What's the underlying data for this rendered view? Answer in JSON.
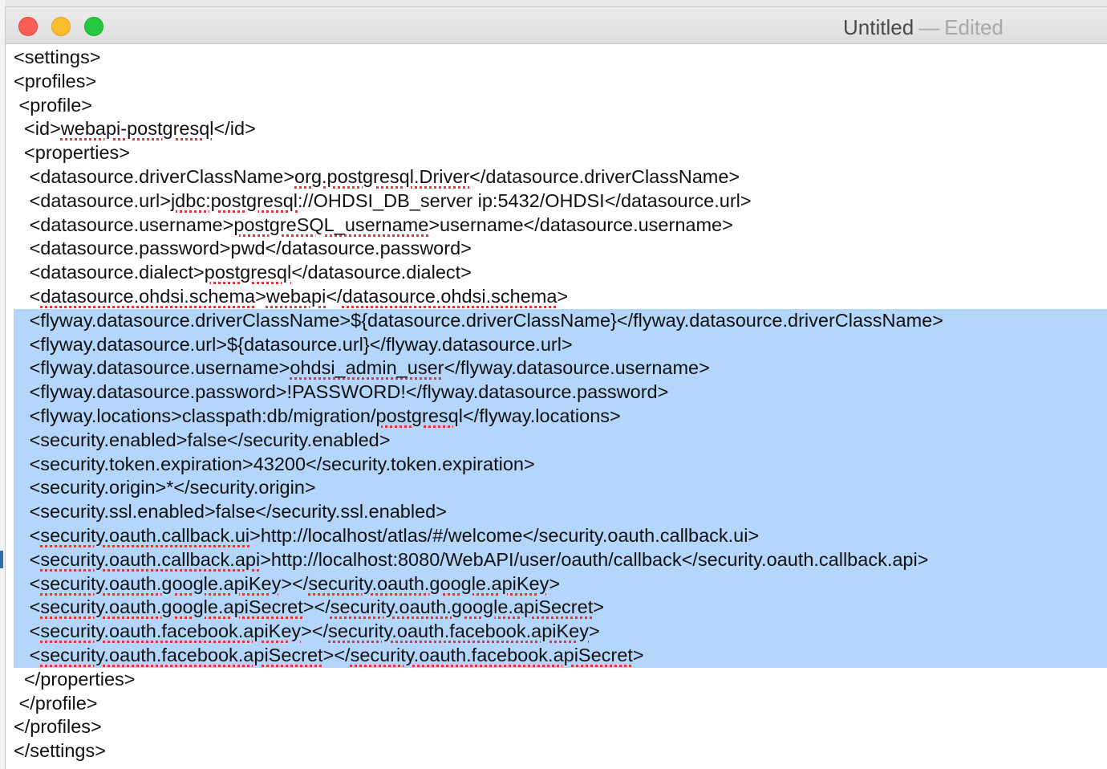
{
  "window": {
    "title": "Untitled",
    "title_separator": "—",
    "title_state": "Edited"
  },
  "colors": {
    "selection": "#b4d6fb",
    "spellcheck_underline": "#e0383a",
    "close_button": "#fd5e56",
    "minimize_button": "#fdbb2f",
    "zoom_button": "#27c840"
  },
  "editor": {
    "lines": [
      {
        "selected": false,
        "segments": [
          {
            "text": "<settings>"
          }
        ]
      },
      {
        "selected": false,
        "segments": [
          {
            "text": "<profiles>"
          }
        ]
      },
      {
        "selected": false,
        "segments": [
          {
            "text": " <profile>"
          }
        ]
      },
      {
        "selected": false,
        "segments": [
          {
            "text": "  <id>"
          },
          {
            "text": "webapi-postgresql",
            "misspelled": true
          },
          {
            "text": "</id>"
          }
        ]
      },
      {
        "selected": false,
        "segments": [
          {
            "text": "  <properties>"
          }
        ]
      },
      {
        "selected": false,
        "segments": [
          {
            "text": "   <datasource.driverClassName>"
          },
          {
            "text": "org.postgresql.Driver",
            "misspelled": true
          },
          {
            "text": "</datasource.driverClassName>"
          }
        ]
      },
      {
        "selected": false,
        "segments": [
          {
            "text": "   <datasource.url>"
          },
          {
            "text": "jdbc:postgresql",
            "misspelled": true
          },
          {
            "text": "://OHDSI_DB_server ip:5432/OHDSI</datasource.url>"
          }
        ]
      },
      {
        "selected": false,
        "segments": [
          {
            "text": "   <datasource.username>"
          },
          {
            "text": "postgreSQL_username",
            "misspelled": true
          },
          {
            "text": ">username</datasource.username>"
          }
        ]
      },
      {
        "selected": false,
        "segments": [
          {
            "text": "   <datasource.password>pwd</datasource.password>"
          }
        ]
      },
      {
        "selected": false,
        "segments": [
          {
            "text": "   <datasource.dialect>"
          },
          {
            "text": "postgresql",
            "misspelled": true
          },
          {
            "text": "</datasource.dialect>"
          }
        ]
      },
      {
        "selected": false,
        "segments": [
          {
            "text": "   <"
          },
          {
            "text": "datasource.ohdsi.schema",
            "misspelled": true
          },
          {
            "text": ">"
          },
          {
            "text": "webapi",
            "misspelled": true
          },
          {
            "text": "</"
          },
          {
            "text": "datasource.ohdsi.schema",
            "misspelled": true
          },
          {
            "text": ">"
          }
        ]
      },
      {
        "selected": true,
        "segments": [
          {
            "text": "   <flyway.datasource.driverClassName>${datasource.driverClassName}</flyway.datasource.driverClassName>"
          }
        ]
      },
      {
        "selected": true,
        "segments": [
          {
            "text": "   <flyway.datasource.url>${datasource.url}</flyway.datasource.url>"
          }
        ]
      },
      {
        "selected": true,
        "segments": [
          {
            "text": "   <flyway.datasource.username>"
          },
          {
            "text": "ohdsi_admin_user",
            "misspelled": true
          },
          {
            "text": "</flyway.datasource.username>"
          }
        ]
      },
      {
        "selected": true,
        "segments": [
          {
            "text": "   <flyway.datasource.password>!PASSWORD!</flyway.datasource.password>"
          }
        ]
      },
      {
        "selected": true,
        "segments": [
          {
            "text": "   <flyway.locations>classpath:db/migration/"
          },
          {
            "text": "postgresql",
            "misspelled": true
          },
          {
            "text": "</flyway.locations>"
          }
        ]
      },
      {
        "selected": true,
        "segments": [
          {
            "text": "   <security.enabled>false</security.enabled>"
          }
        ]
      },
      {
        "selected": true,
        "segments": [
          {
            "text": "   <security.token.expiration>43200</security.token.expiration>"
          }
        ]
      },
      {
        "selected": true,
        "segments": [
          {
            "text": "   <security.origin>*</security.origin>"
          }
        ]
      },
      {
        "selected": true,
        "segments": [
          {
            "text": "   <security.ssl.enabled>false</security.ssl.enabled>"
          }
        ]
      },
      {
        "selected": true,
        "segments": [
          {
            "text": "   <"
          },
          {
            "text": "security.oauth.callback.ui",
            "misspelled": true
          },
          {
            "text": ">http://localhost/atlas/#/welcome</security.oauth.callback.ui>"
          }
        ]
      },
      {
        "selected": true,
        "segments": [
          {
            "text": "   <"
          },
          {
            "text": "security.oauth.callback.api",
            "misspelled": true
          },
          {
            "text": ">http://localhost:8080/WebAPI/user/oauth/callback</security.oauth.callback.api>"
          }
        ]
      },
      {
        "selected": true,
        "segments": [
          {
            "text": "   <"
          },
          {
            "text": "security.oauth.google.apiKey",
            "misspelled": true
          },
          {
            "text": "></"
          },
          {
            "text": "security.oauth.google.apiKey",
            "misspelled": true
          },
          {
            "text": ">"
          }
        ]
      },
      {
        "selected": true,
        "segments": [
          {
            "text": "   <"
          },
          {
            "text": "security.oauth.google.apiSecret",
            "misspelled": true
          },
          {
            "text": "></"
          },
          {
            "text": "security.oauth.google.apiSecret",
            "misspelled": true
          },
          {
            "text": ">"
          }
        ]
      },
      {
        "selected": true,
        "segments": [
          {
            "text": "   <"
          },
          {
            "text": "security.oauth.facebook.apiKey",
            "misspelled": true
          },
          {
            "text": "></"
          },
          {
            "text": "security.oauth.facebook.apiKey",
            "misspelled": true
          },
          {
            "text": ">"
          }
        ]
      },
      {
        "selected": true,
        "segments": [
          {
            "text": "   <"
          },
          {
            "text": "security.oauth.facebook.apiSecret",
            "misspelled": true
          },
          {
            "text": "></"
          },
          {
            "text": "security.oauth.facebook.apiSecret",
            "misspelled": true
          },
          {
            "text": ">"
          }
        ]
      },
      {
        "selected": false,
        "segments": [
          {
            "text": "  </properties>"
          }
        ]
      },
      {
        "selected": false,
        "segments": [
          {
            "text": " </profile>"
          }
        ]
      },
      {
        "selected": false,
        "segments": [
          {
            "text": "</profiles>"
          }
        ]
      },
      {
        "selected": false,
        "segments": [
          {
            "text": "</settings>"
          }
        ]
      }
    ]
  }
}
